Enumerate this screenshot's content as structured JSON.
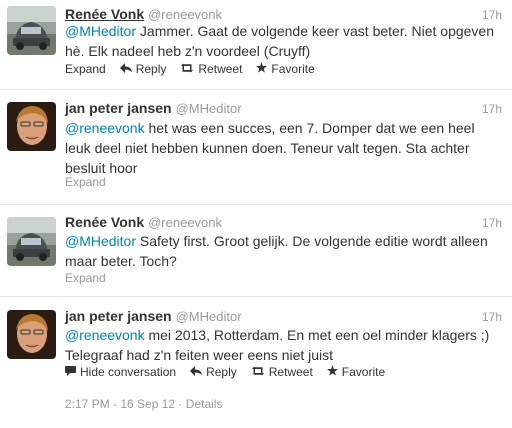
{
  "tweets": [
    {
      "fullname": "Renée Vonk",
      "username": "@reneevonk",
      "time": "17h",
      "mention": "@MHeditor",
      "text": " Jammer. Gaat de volgende keer vast beter. Niet opgeven hè. Elk nadeel heb z'n voordeel (Cruyff)",
      "expand": "Expand",
      "reply": "Reply",
      "retweet": "Retweet",
      "favorite": "Favorite"
    },
    {
      "fullname": "jan peter jansen",
      "username": "@MHeditor",
      "time": "17h",
      "mention": "@reneevonk",
      "text": " het was een succes, een 7. Domper dat we een heel leuk deel niet hebben kunnen doen. Teneur valt tegen. Sta achter besluit hoor",
      "expand": "Expand"
    },
    {
      "fullname": "Renée Vonk",
      "username": "@reneevonk",
      "time": "17h",
      "mention": "@MHeditor",
      "text": " Safety first. Groot gelijk. De volgende editie wordt alleen maar beter. Toch?",
      "expand": "Expand"
    },
    {
      "fullname": "jan peter jansen",
      "username": "@MHeditor",
      "time": "17h",
      "mention": "@reneevonk",
      "text": " mei 2013, Rotterdam. En met een oel minder klagers ;) Telegraaf had z'n feiten weer eens niet juist",
      "hide": "Hide conversation",
      "reply": "Reply",
      "retweet": "Retweet",
      "favorite": "Favorite",
      "timestamp": "2:17 PM - 16 Sep 12",
      "separator": "·",
      "details": "Details"
    }
  ],
  "colors": {
    "link": "#0084b4",
    "muted": "#999999",
    "text": "#333333"
  },
  "icons": {
    "reply": "reply-icon",
    "retweet": "retweet-icon",
    "favorite": "star-icon",
    "hide": "speech-bubble-icon"
  }
}
